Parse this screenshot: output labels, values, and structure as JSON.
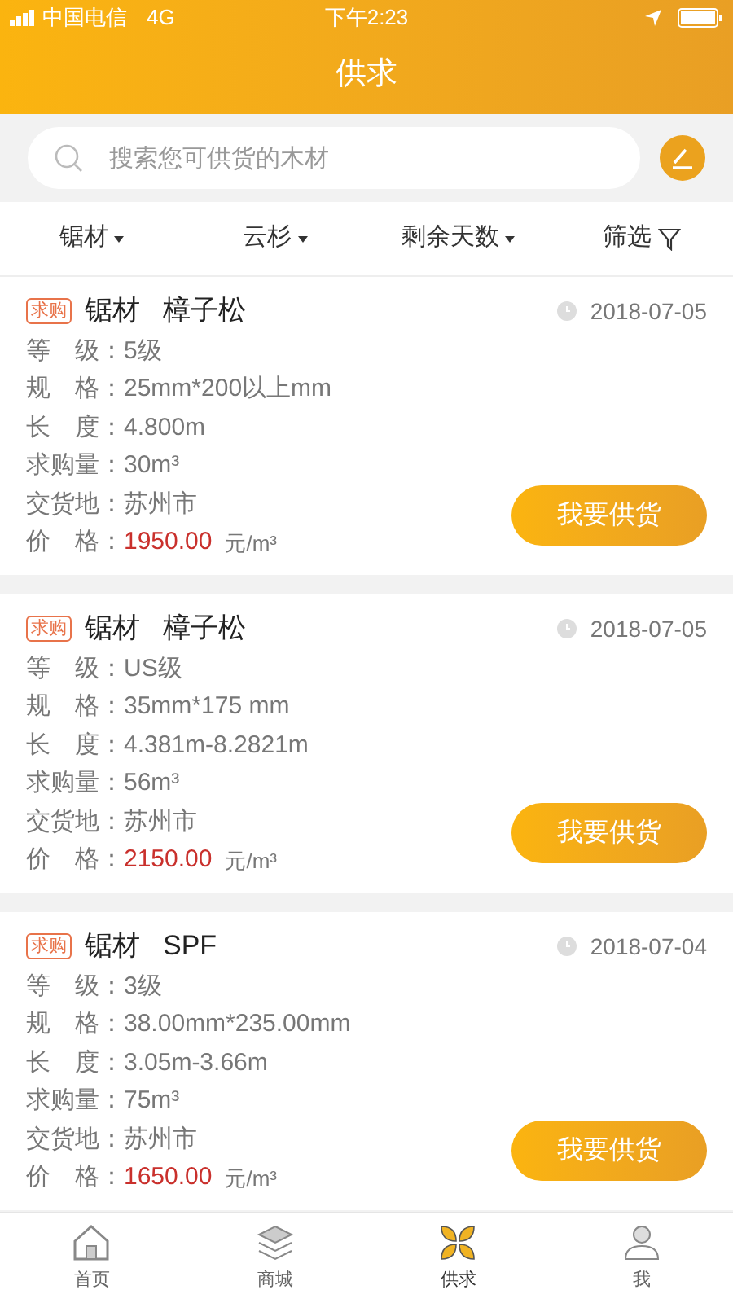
{
  "status_bar": {
    "carrier": "中国电信",
    "network": "4G",
    "time": "下午2:23"
  },
  "header": {
    "title": "供求"
  },
  "search": {
    "placeholder": "搜索您可供货的木材"
  },
  "filters": [
    {
      "label": "锯材",
      "kind": "dropdown"
    },
    {
      "label": "云杉",
      "kind": "dropdown"
    },
    {
      "label": "剩余天数",
      "kind": "dropdown"
    },
    {
      "label": "筛选",
      "kind": "filter"
    }
  ],
  "listings": [
    {
      "tag": "求购",
      "category": "锯材",
      "species": "樟子松",
      "date": "2018-07-05",
      "fields": [
        {
          "label": "等　级：",
          "value": "5级"
        },
        {
          "label": "规　格：",
          "value": "25mm*200以上mm"
        },
        {
          "label": "长　度：",
          "value": "4.800m"
        },
        {
          "label": "求购量：",
          "value": "30m³"
        },
        {
          "label": "交货地：",
          "value": "苏州市"
        }
      ],
      "price_label": "价　格：",
      "price": "1950.00",
      "unit": "元/m³",
      "action": "我要供货"
    },
    {
      "tag": "求购",
      "category": "锯材",
      "species": "樟子松",
      "date": "2018-07-05",
      "fields": [
        {
          "label": "等　级：",
          "value": "US级"
        },
        {
          "label": "规　格：",
          "value": "35mm*175 mm"
        },
        {
          "label": "长　度：",
          "value": "4.381m-8.2821m"
        },
        {
          "label": "求购量：",
          "value": "56m³"
        },
        {
          "label": "交货地：",
          "value": "苏州市"
        }
      ],
      "price_label": "价　格：",
      "price": "2150.00",
      "unit": "元/m³",
      "action": "我要供货"
    },
    {
      "tag": "求购",
      "category": "锯材",
      "species": "SPF",
      "date": "2018-07-04",
      "fields": [
        {
          "label": "等　级：",
          "value": "3级"
        },
        {
          "label": "规　格：",
          "value": "38.00mm*235.00mm"
        },
        {
          "label": "长　度：",
          "value": "3.05m-3.66m"
        },
        {
          "label": "求购量：",
          "value": "75m³"
        },
        {
          "label": "交货地：",
          "value": "苏州市"
        }
      ],
      "price_label": "价　格：",
      "price": "1650.00",
      "unit": "元/m³",
      "action": "我要供货"
    }
  ],
  "tab_bar": [
    {
      "label": "首页",
      "selected": false
    },
    {
      "label": "商城",
      "selected": false
    },
    {
      "label": "供求",
      "selected": true
    },
    {
      "label": "我",
      "selected": false
    }
  ]
}
